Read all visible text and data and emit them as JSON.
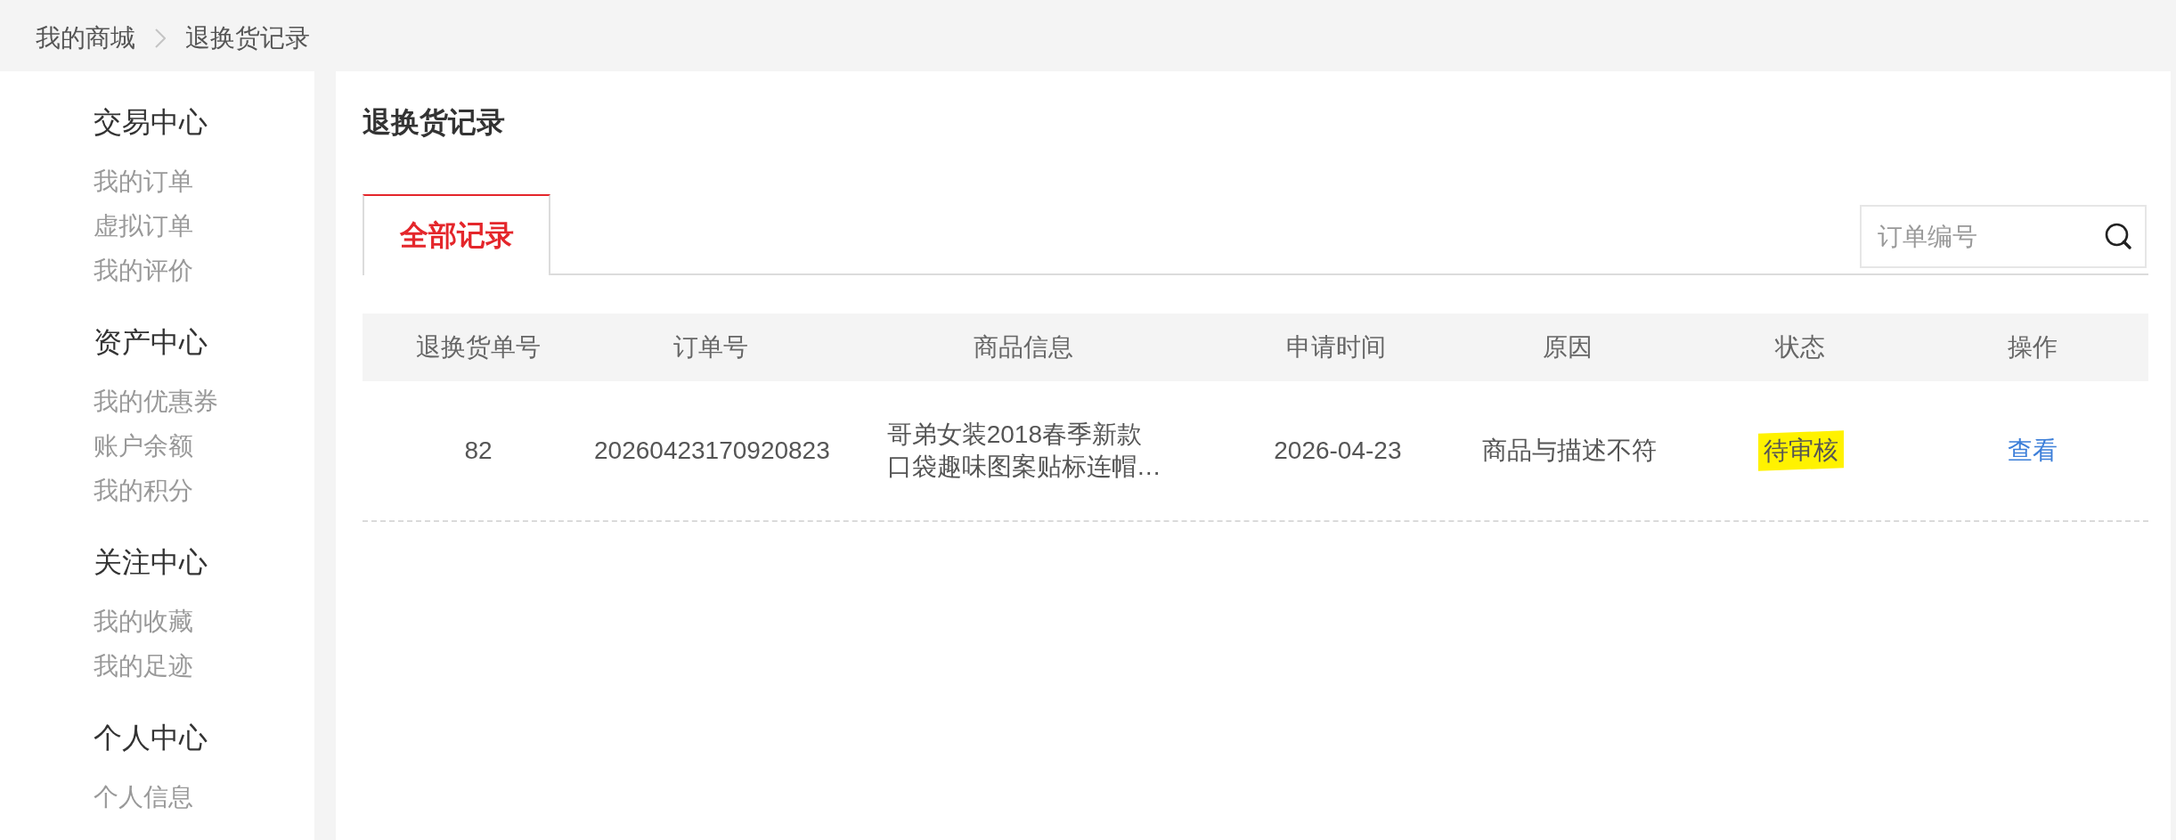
{
  "breadcrumb": [
    {
      "label": "我的商城"
    },
    {
      "label": "退换货记录"
    }
  ],
  "sidebar": {
    "groups": [
      {
        "title": "交易中心",
        "items": [
          {
            "label": "我的订单"
          },
          {
            "label": "虚拟订单"
          },
          {
            "label": "我的评价"
          }
        ]
      },
      {
        "title": "资产中心",
        "items": [
          {
            "label": "我的优惠券"
          },
          {
            "label": "账户余额"
          },
          {
            "label": "我的积分"
          }
        ]
      },
      {
        "title": "关注中心",
        "items": [
          {
            "label": "我的收藏"
          },
          {
            "label": "我的足迹"
          }
        ]
      },
      {
        "title": "个人中心",
        "items": [
          {
            "label": "个人信息"
          }
        ]
      }
    ]
  },
  "page_title": "退换货记录",
  "tabs": [
    {
      "label": "全部记录",
      "selected": true
    }
  ],
  "search": {
    "placeholder": "订单编号"
  },
  "table": {
    "columns": [
      "退换货单号",
      "订单号",
      "商品信息",
      "申请时间",
      "原因",
      "状态",
      "操作"
    ],
    "rows": [
      {
        "cells": [
          {
            "kind": "text",
            "text": "82"
          },
          {
            "kind": "text",
            "text": "20260423170920823"
          },
          {
            "kind": "product",
            "text": "哥弟女装2018春季新款口袋趣味图案贴标连帽…"
          },
          {
            "kind": "text",
            "text": "2026-04-23"
          },
          {
            "kind": "text",
            "text": "商品与描述不符"
          },
          {
            "kind": "status",
            "text": "待审核",
            "highlighted": true
          },
          {
            "kind": "link",
            "text": "查看"
          }
        ]
      }
    ]
  }
}
